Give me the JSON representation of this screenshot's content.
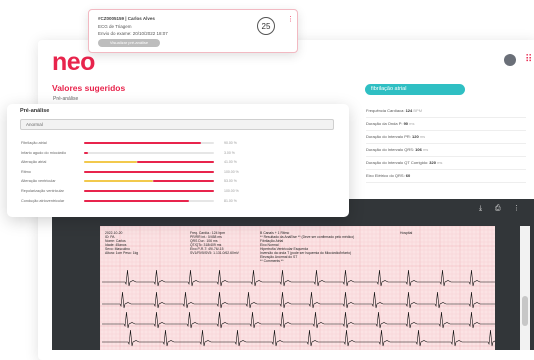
{
  "notification": {
    "line1": "#CZ0005159 | Carlos Alves",
    "line2": "ECG de Triagem",
    "line3": "Envio do exame: 20/10/2022 18:07",
    "button": "Visualizar pré-análise",
    "counter": "25"
  },
  "brand": {
    "logo": "neo",
    "accent": "#e8244c",
    "teal": "#2fbfc3"
  },
  "main": {
    "suggested_title": "Valores sugeridos",
    "pre_label": "Pré-análise"
  },
  "diagnosis": {
    "pill": "fibrilação atrial",
    "measures": [
      {
        "label": "Frequência Cardíaca:",
        "value": "124",
        "unit": "BPM"
      },
      {
        "label": "Duração da Onda P:",
        "value": "90",
        "unit": "ms"
      },
      {
        "label": "Duração do Intervalo PR:",
        "value": "120",
        "unit": "ms"
      },
      {
        "label": "Duração do Intervalo QRS:",
        "value": "106",
        "unit": "ms"
      },
      {
        "label": "Duração do Intervalo QT Corrigido:",
        "value": "320",
        "unit": "ms"
      },
      {
        "label": "Eixo Elétrico do QRS:",
        "value": "60",
        "unit": ""
      }
    ]
  },
  "pre_analysis": {
    "title": "Pré-análise",
    "result": "Anormal",
    "bars": [
      {
        "label": "Fibrilação atrial",
        "percent": 90,
        "pct_text": "90.00 %",
        "color": "#e8244c"
      },
      {
        "label": "Infarto agudo do miocárdio",
        "percent": 3,
        "pct_text": "3.00 %",
        "color": "#e8244c"
      },
      {
        "label": "Alteração atrial",
        "percent": 41,
        "pct_text": "41.00 %",
        "color": "#f2c94c",
        "rest_color": "#e8244c"
      },
      {
        "label": "Ritmo",
        "percent": 100,
        "pct_text": "100.00 %",
        "color": "#e8244c"
      },
      {
        "label": "Alteração ventricular",
        "percent": 53,
        "pct_text": "53.00 %",
        "color": "#f2c94c",
        "rest_color": "#e8244c"
      },
      {
        "label": "Repolarização ventricular",
        "percent": 100,
        "pct_text": "100.00 %",
        "color": "#e8244c"
      },
      {
        "label": "Condução atrioventricular",
        "percent": 81,
        "pct_text": "81.00 %",
        "color": "#e8244c"
      }
    ]
  },
  "ecg": {
    "header_left": [
      "2022-10-20",
      "ID: PA",
      "Nome: Carlos",
      "Idade: 45anos",
      "Sexo: Masculino",
      "Altura: 1cm  Peso: 1kg"
    ],
    "header_mid": [
      "Freq. Cardía.: 124 bpm",
      "PR/RR int.: 0/458 ms",
      "QRS Dur.: 106 ms",
      "QT/QTc: 318/409 ms",
      "Eixo P-R-T: 49/-76/-15",
      "SV1/RV5/SV5: 1.131.0/62.60mV"
    ],
    "header_right": [
      "B Canais + 1 Ritmo",
      "** Resultado da AnáEise ** (Deve ser confirmado pelo médico)",
      "Fibrilação Atrial",
      "Eixo Normal",
      "Hipertrofia Ventricular Esquerda",
      "Inversão da onda T (pode ser Isquemia do Miocárdio/Infarto)",
      "Elevação Anormal do ST",
      "** Comments **"
    ],
    "hospital": "Hospital",
    "viewer_icons": [
      "download-icon",
      "print-icon",
      "more-icon"
    ]
  }
}
